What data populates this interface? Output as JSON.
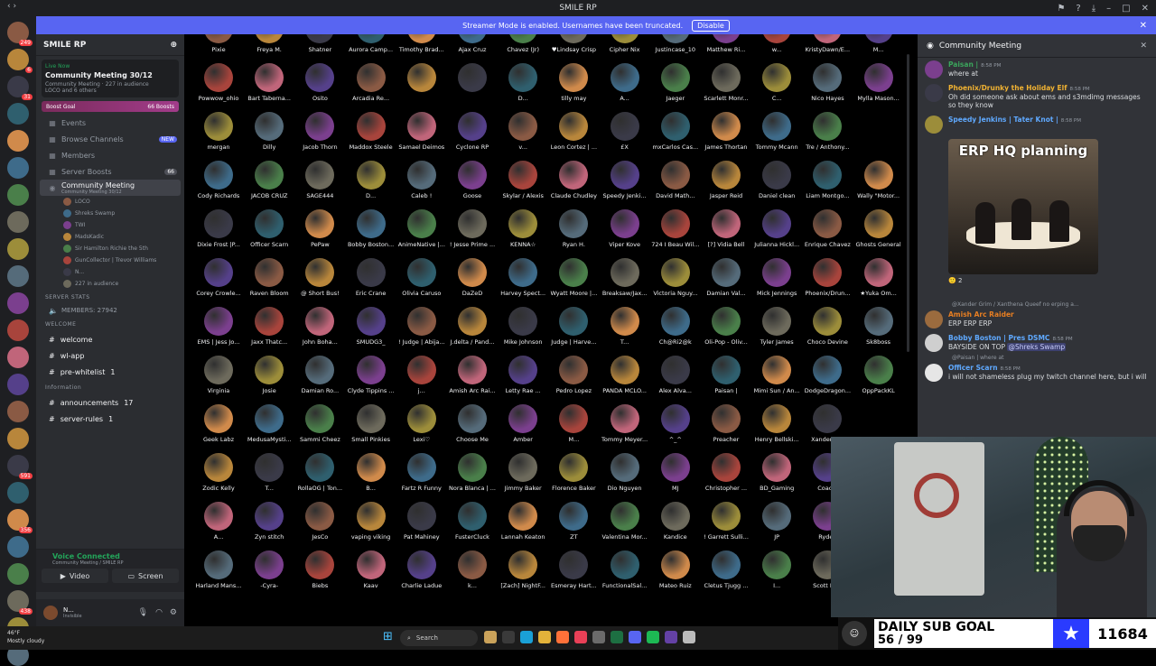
{
  "titlebar": {
    "title": "SMILE RP"
  },
  "streamer_banner": {
    "text": "Streamer Mode is enabled. Usernames have been truncated.",
    "button": "Disable"
  },
  "guild_badges": [
    "249",
    "6",
    "31",
    "",
    "",
    "",
    "",
    "",
    "",
    "",
    "",
    "",
    "",
    "",
    "",
    "",
    "591",
    "",
    "356",
    "",
    "",
    "438",
    "NEW",
    ""
  ],
  "server": {
    "name": "SMILE RP",
    "live": {
      "tag": "Live Now",
      "title": "Community Meeting 30/12",
      "sub": "Community Meeting",
      "audience": "227 in audience",
      "others": "LOCO and 6 others"
    },
    "boost": {
      "label": "Boost Goal",
      "count": "66 Boosts"
    },
    "nav": [
      {
        "label": "Events",
        "icon": "calendar-icon",
        "badge": ""
      },
      {
        "label": "Browse Channels",
        "icon": "browse-icon",
        "badge": "NEW"
      },
      {
        "label": "Members",
        "icon": "members-icon",
        "badge": ""
      },
      {
        "label": "Server Boosts",
        "icon": "boost-icon",
        "badge": "66"
      }
    ],
    "stage_channel": {
      "label": "Community Meeting",
      "sub": "Community Meeting 30/12"
    },
    "speakers": [
      "LOCO",
      "Shreks Swamp",
      "TWI",
      "MadsKadic",
      "Sir Hamilton Richie the 5th",
      "GunCollector | Trevor Williams",
      "N...",
      "227 in audience"
    ],
    "categories": {
      "stats": "SERVER STATS",
      "welcome": "WELCOME",
      "info": "Information"
    },
    "members_count": "MEMBERS: 27942",
    "channels": [
      {
        "label": "welcome",
        "badge": ""
      },
      {
        "label": "wl-app",
        "badge": ""
      },
      {
        "label": "pre-whitelist",
        "badge": "1"
      },
      {
        "label": "announcements",
        "badge": "17"
      },
      {
        "label": "server-rules",
        "badge": "1"
      }
    ]
  },
  "voice": {
    "status": "Voice Connected",
    "channel": "Community Meeting / SMILE RP",
    "video": "Video",
    "screen": "Screen"
  },
  "user": {
    "name": "N...",
    "status": "Invisible"
  },
  "audience": [
    [
      "Pixie",
      "Freya M.",
      "Shatner",
      "Aurora Camp...",
      "Timothy Brad...",
      "Ajax Cruz",
      "Chavez (Jr)",
      "♥Lindsay Crisp",
      "Cipher Nix",
      "Justincase_10",
      "Matthew Ri...",
      "w...",
      "KristyDawn/E...",
      "M..."
    ],
    [
      "Powwow_ohio",
      "Bart Taberna...",
      "Osito",
      "Arcadia Re...",
      "",
      "",
      "D...",
      "tilly may",
      "A...",
      "Jaeger",
      "Scarlett Monr...",
      "C...",
      "Nico Hayes",
      "Mylla Mason..."
    ],
    [
      "mergan",
      "Dilly",
      "Jacob Thorn",
      "Maddox Steele",
      "Samael Deimos",
      "Cyclone RP",
      "v...",
      "Leon Cortez | ...",
      "£X",
      "mxCarlos Cas...",
      "James Thortan",
      "Tommy Mcann",
      "Tre / Anthony..."
    ],
    [
      "Cody Richards",
      "JACOB CRUZ",
      "SAGE444",
      "D...",
      "Caleb !",
      "Goose",
      "Skylar / Alexis",
      "Claude Chudley",
      "Speedy Jenki...",
      "David Math...",
      "Jasper Reid",
      "Daniel clean",
      "Liam Montgo...",
      "Wally \"Motor..."
    ],
    [
      "Dixie Frost |P...",
      "Officer Scarn",
      "PePaw",
      "Bobby Boston...",
      "AnimeNative |...",
      "! Jesse Prime ...",
      "KENNA☆",
      "Ryan H.",
      "Viper Kove",
      "724 I Beau Wil...",
      "[?] Vidia Bell",
      "Julianna Hickl...",
      "Enrique Chavez",
      "Ghosts General"
    ],
    [
      "Corey Crowle...",
      "Raven Bloom",
      "@ Short Bus!",
      "Eric Crane",
      "Olivia Caruso",
      "DaZeD",
      "Harvey Spect...",
      "Wyatt Moore |...",
      "Breaksaw/Jax...",
      "Victoria Nguy...",
      "Damian Val...",
      "Mick Jennings",
      "Phoenix/Drun...",
      "★Yuka Om..."
    ],
    [
      "EMS | Jess Jo...",
      "Jaxx Thatc...",
      "John Boha...",
      "SMUDG3_",
      "! Judge | Abija...",
      "J.delta / Pand...",
      "Mike Johnson",
      "Judge | Harve...",
      "T...",
      "Ch@Ri2@k",
      "Oli-Pop - Oliv...",
      "Tyler James",
      "Choco Devine",
      "Sk8boss"
    ],
    [
      "Virginia",
      "Josie",
      "Damian Ro...",
      "Clyde Tippins ...",
      "j...",
      "Amish Arc Rai...",
      "Letty Rae ...",
      "Pedro Lopez",
      "PANDA MCLO...",
      "Alex Alva...",
      "Paisan |",
      "Mimi Sun / An...",
      "DodgeDragon...",
      "OppPackKL"
    ],
    [
      "Geek Labz",
      "MedusaMysti...",
      "Sammi Cheez",
      "Small Pinkies",
      "Lexi♡",
      "Choose Me",
      "Amber",
      "M...",
      "Tommy Meyer...",
      "^_^",
      "Preacher",
      "Henry Bellski...",
      "Xander G..."
    ],
    [
      "Zodic Kelly",
      "T...",
      "RollaOG | Ton...",
      "B...",
      "Fartz R Funny",
      "Nora Blanca | ...",
      "Jimmy Baker",
      "Florence Baker",
      "Dio Nguyen",
      "MJ",
      "Christopher ...",
      "BD_Gaming",
      "Coac..."
    ],
    [
      "A...",
      "Zyn stitch",
      "JesCo",
      "vaping viking",
      "Pat Mahiney",
      "FusterCluck",
      "Lannah Keaton",
      "ZT",
      "Valentina Mor...",
      "Kandice",
      "! Garrett Sulli...",
      "JP",
      "Ryden"
    ],
    [
      "Harland Mans...",
      "-Cyra-",
      "Biebs",
      "Kaav",
      "Charlie Ladue",
      "k...",
      "[Zach] NightF...",
      "Esmeray Hart...",
      "FunctionalSal...",
      "Mateo Ruiz",
      "Cletus Tjugg ...",
      "I...",
      "Scott Pa..."
    ]
  ],
  "chat": {
    "title": "Community Meeting",
    "messages": [
      {
        "user": "Paisan |",
        "time": "8:58 PM",
        "text": "where at",
        "color": "#3ba55c"
      },
      {
        "user": "Phoenix/Drunky the Holiday Elf",
        "time": "8:58 PM",
        "text": "Oh did someone ask about ems and s3mdimg messages so they know",
        "color": "#f0b232"
      },
      {
        "user": "Speedy Jenkins | Tater Knot |",
        "time": "8:58 PM",
        "text": "",
        "color": "#5fa9ff"
      }
    ],
    "gif_caption": "ERP HQ planning",
    "reaction": "2",
    "reply1": "@Xander Grim / Xanthena Queef no erping a...",
    "msg4": {
      "user": "Amish Arc Raider",
      "text": "ERP ERP ERP",
      "color": "#e67e22"
    },
    "msg5": {
      "user": "Bobby Boston | Pres DSMC",
      "time": "8:58 PM",
      "text": "BAYSIDE ON TOP",
      "mention": "@Shreks Swamp",
      "color": "#5fa9ff"
    },
    "reply2": "@Paisan | where at",
    "msg6": {
      "user": "Officer Scarn",
      "time": "8:58 PM",
      "text": "i will not shameless plug my twitch channel here, but i will",
      "color": "#5fa9ff"
    }
  },
  "goal": {
    "title": "DAILY SUB GOAL",
    "progress": "56 / 99",
    "total": "11684"
  },
  "taskbar": {
    "temp": "46°F",
    "weather": "Mostly cloudy",
    "search": "Search"
  },
  "colors": {
    "accent": "#5865f2",
    "online": "#23a55a",
    "danger": "#f23f43"
  }
}
